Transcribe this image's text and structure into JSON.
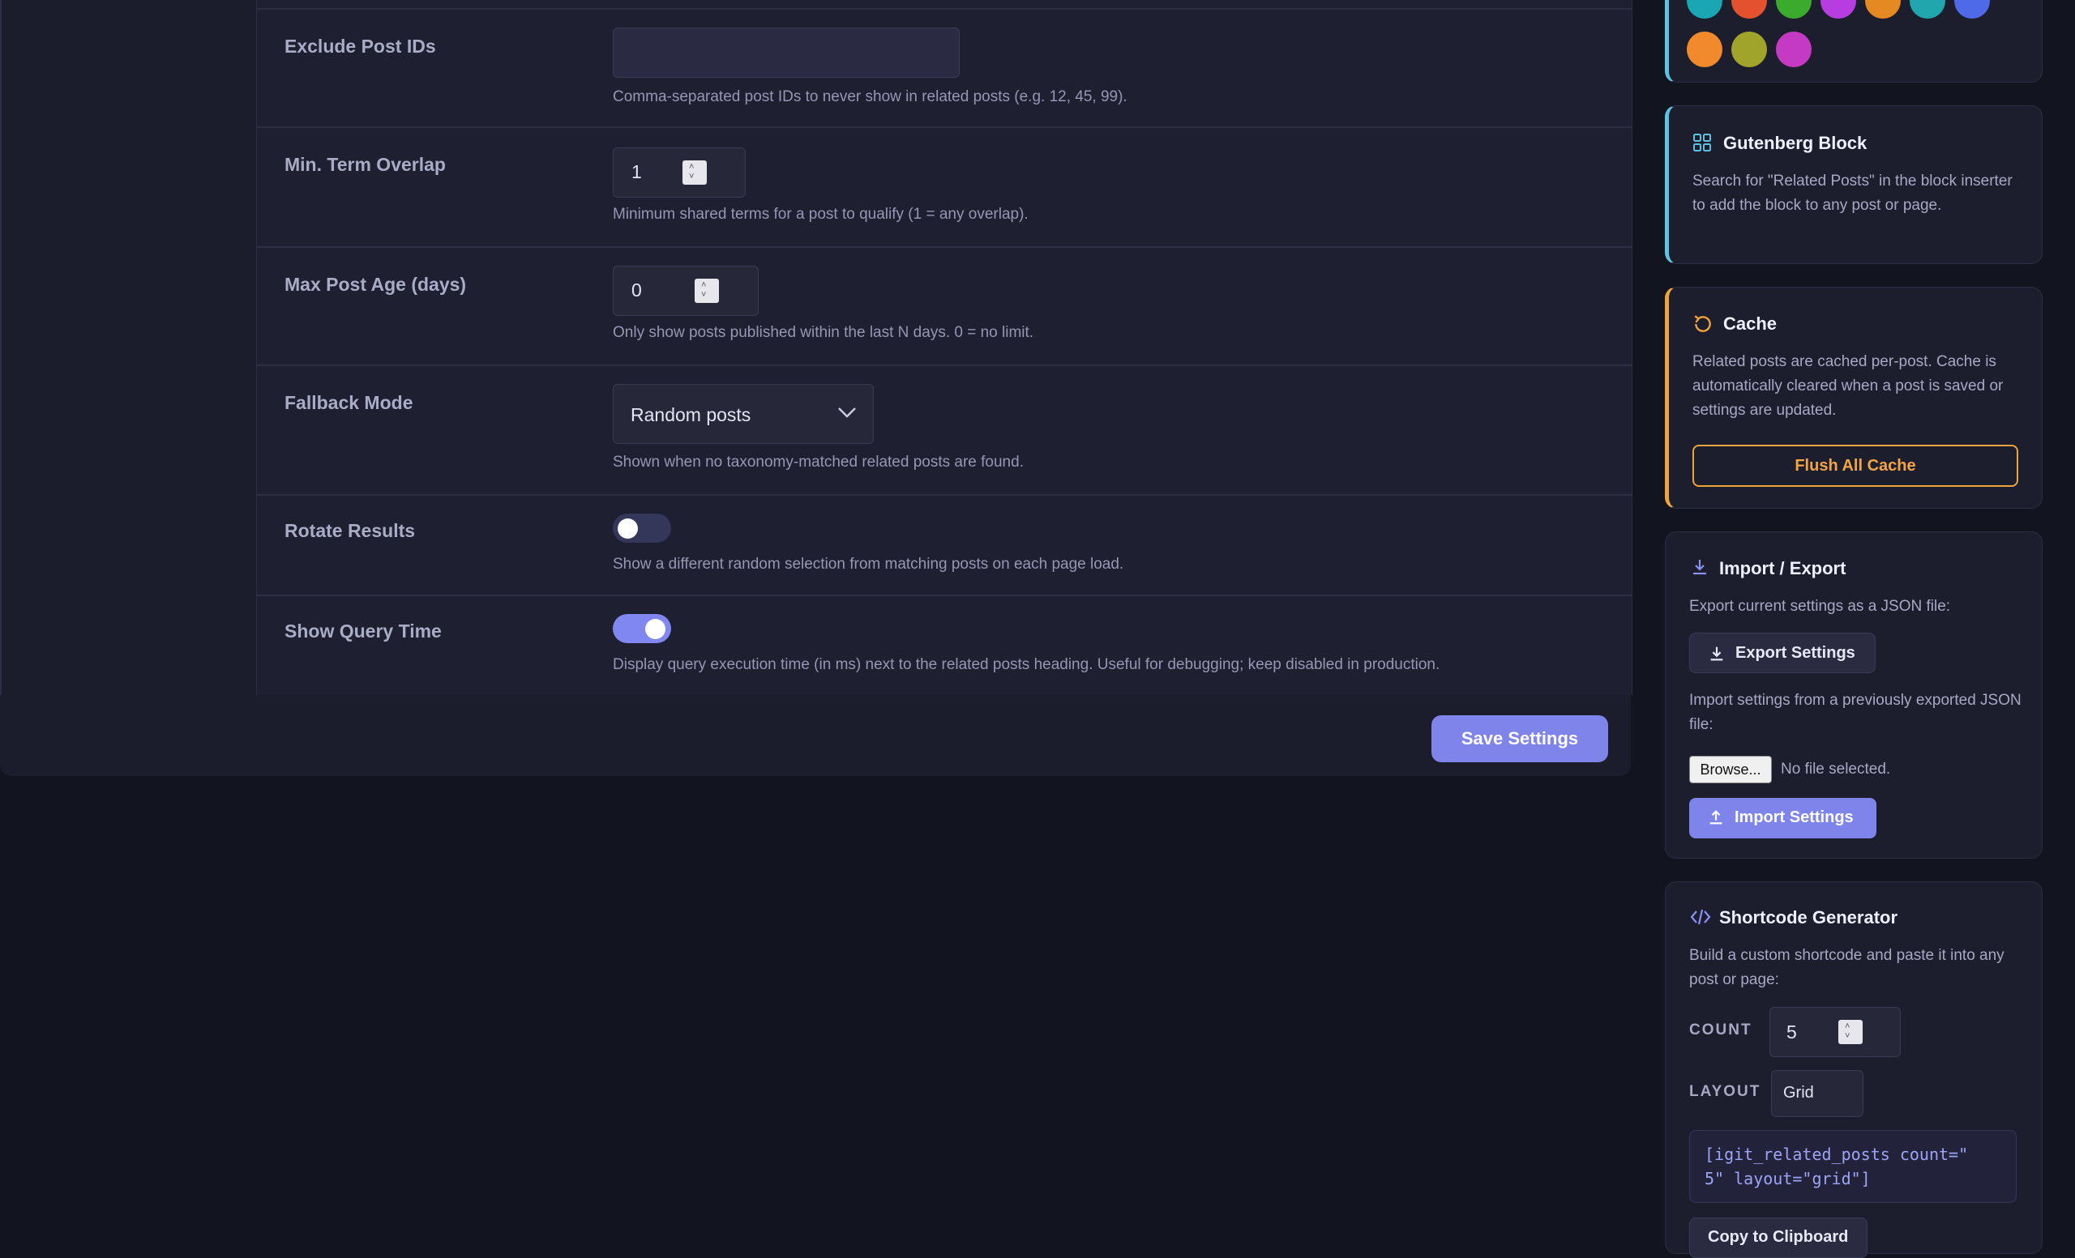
{
  "settings": {
    "exclude_post_ids": {
      "label": "Exclude Post IDs",
      "value": "",
      "help": "Comma-separated post IDs to never show in related posts (e.g. 12, 45, 99)."
    },
    "min_term_overlap": {
      "label": "Min. Term Overlap",
      "value": "1",
      "help": "Minimum shared terms for a post to qualify (1 = any overlap)."
    },
    "max_post_age": {
      "label": "Max Post Age (days)",
      "value": "0",
      "help": "Only show posts published within the last N days. 0 = no limit."
    },
    "fallback_mode": {
      "label": "Fallback Mode",
      "selected": "Random posts",
      "help": "Shown when no taxonomy-matched related posts are found."
    },
    "rotate_results": {
      "label": "Rotate Results",
      "enabled": false,
      "help": "Show a different random selection from matching posts on each page load."
    },
    "show_query_time": {
      "label": "Show Query Time",
      "enabled": true,
      "help": "Display query execution time (in ms) next to the related posts heading. Useful for debugging; keep disabled in production."
    }
  },
  "save_button": "Save Settings",
  "color_swatches": [
    "#1aa7b3",
    "#e4512f",
    "#3bab2e",
    "#b73de0",
    "#e58a23",
    "#21a6ad",
    "#4e6ae8",
    "#f08a2c",
    "#a1a42a",
    "#c43ac2"
  ],
  "sidebar": {
    "gutenberg": {
      "title": "Gutenberg Block",
      "icon": "blocks-grid-icon",
      "text": "Search for \"Related Posts\" in the block inserter to add the block to any post or page."
    },
    "cache": {
      "title": "Cache",
      "icon": "refresh-icon",
      "text": "Related posts are cached per-post. Cache is automatically cleared when a post is saved or settings are updated.",
      "button": "Flush All Cache"
    },
    "import_export": {
      "title": "Import / Export",
      "icon": "download-icon",
      "export_text": "Export current settings as a JSON file:",
      "export_button": "Export Settings",
      "import_text": "Import settings from a previously exported JSON file:",
      "browse_button": "Browse...",
      "file_status": "No file selected.",
      "import_button": "Import Settings"
    },
    "shortcode": {
      "title": "Shortcode Generator",
      "icon": "code-icon",
      "text": "Build a custom shortcode and paste it into any post or page:",
      "count_label": "COUNT",
      "count_value": "5",
      "layout_label": "LAYOUT",
      "layout_value": "Grid",
      "code_line1": "[igit_related_posts count=\"",
      "code_line2": "5\" layout=\"grid\"]",
      "copy_button": "Copy to Clipboard"
    }
  }
}
